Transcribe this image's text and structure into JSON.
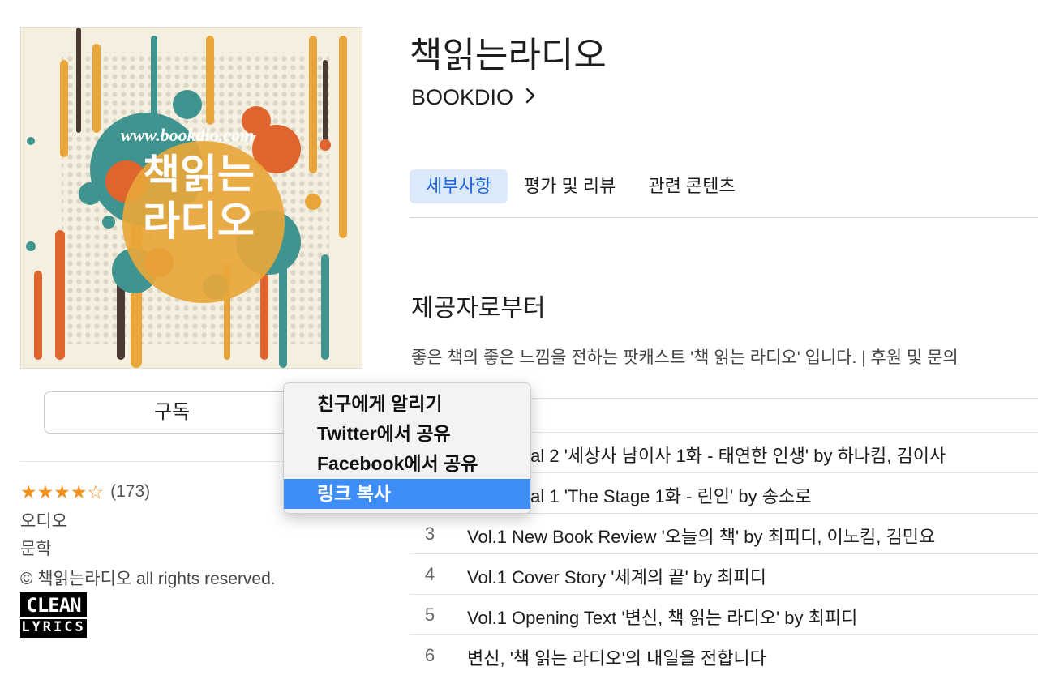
{
  "podcast": {
    "title": "책읽는라디오",
    "provider": "BOOKDIO",
    "artwork_url_text": "www.bookdio.com",
    "artwork_line1": "책읽는",
    "artwork_line2": "라디오"
  },
  "subscribe_label": "구독",
  "rating": {
    "stars": "★★★★☆",
    "value": 4,
    "count": "(173)"
  },
  "category": "오디오",
  "genre": "문학",
  "copyright": "© 책읽는라디오 all rights reserved.",
  "badge": {
    "line1": "CLEAN",
    "line2": "LYRICS"
  },
  "tabs": [
    {
      "label": "세부사항",
      "active": true
    },
    {
      "label": "평가 및 리뷰",
      "active": false
    },
    {
      "label": "관련 콘텐츠",
      "active": false
    }
  ],
  "section_title": "제공자로부터",
  "description": "좋은 책의 좋은 느낌을 전하는 팟캐스트 '책 읽는 라디오' 입니다. | 후원 및 문의",
  "tracks": [
    {
      "num": "",
      "title": ""
    },
    {
      "num": "",
      "title": "Serial 2 '세상사 남이사 1화 - 태연한 인생' by 하나킴, 김이사"
    },
    {
      "num": "",
      "title": "Serial 1 'The Stage 1화 - 린인' by 송소로"
    },
    {
      "num": "3",
      "title": "Vol.1 New Book Review '오늘의 책' by 최피디, 이노킴, 김민요"
    },
    {
      "num": "4",
      "title": "Vol.1 Cover Story '세계의 끝' by 최피디"
    },
    {
      "num": "5",
      "title": "Vol.1 Opening Text '변신, 책 읽는 라디오' by 최피디"
    },
    {
      "num": "6",
      "title": "변신, '책 읽는 라디오'의 내일을 전합니다"
    }
  ],
  "context_menu": [
    {
      "label": "친구에게 알리기",
      "highlighted": false
    },
    {
      "label": "Twitter에서 공유",
      "highlighted": false
    },
    {
      "label": "Facebook에서 공유",
      "highlighted": false
    },
    {
      "label": "링크 복사",
      "highlighted": true
    }
  ],
  "colors": {
    "accent": "#1a66d9",
    "menu_highlight": "#3f8ef8",
    "star": "#f5921d"
  }
}
